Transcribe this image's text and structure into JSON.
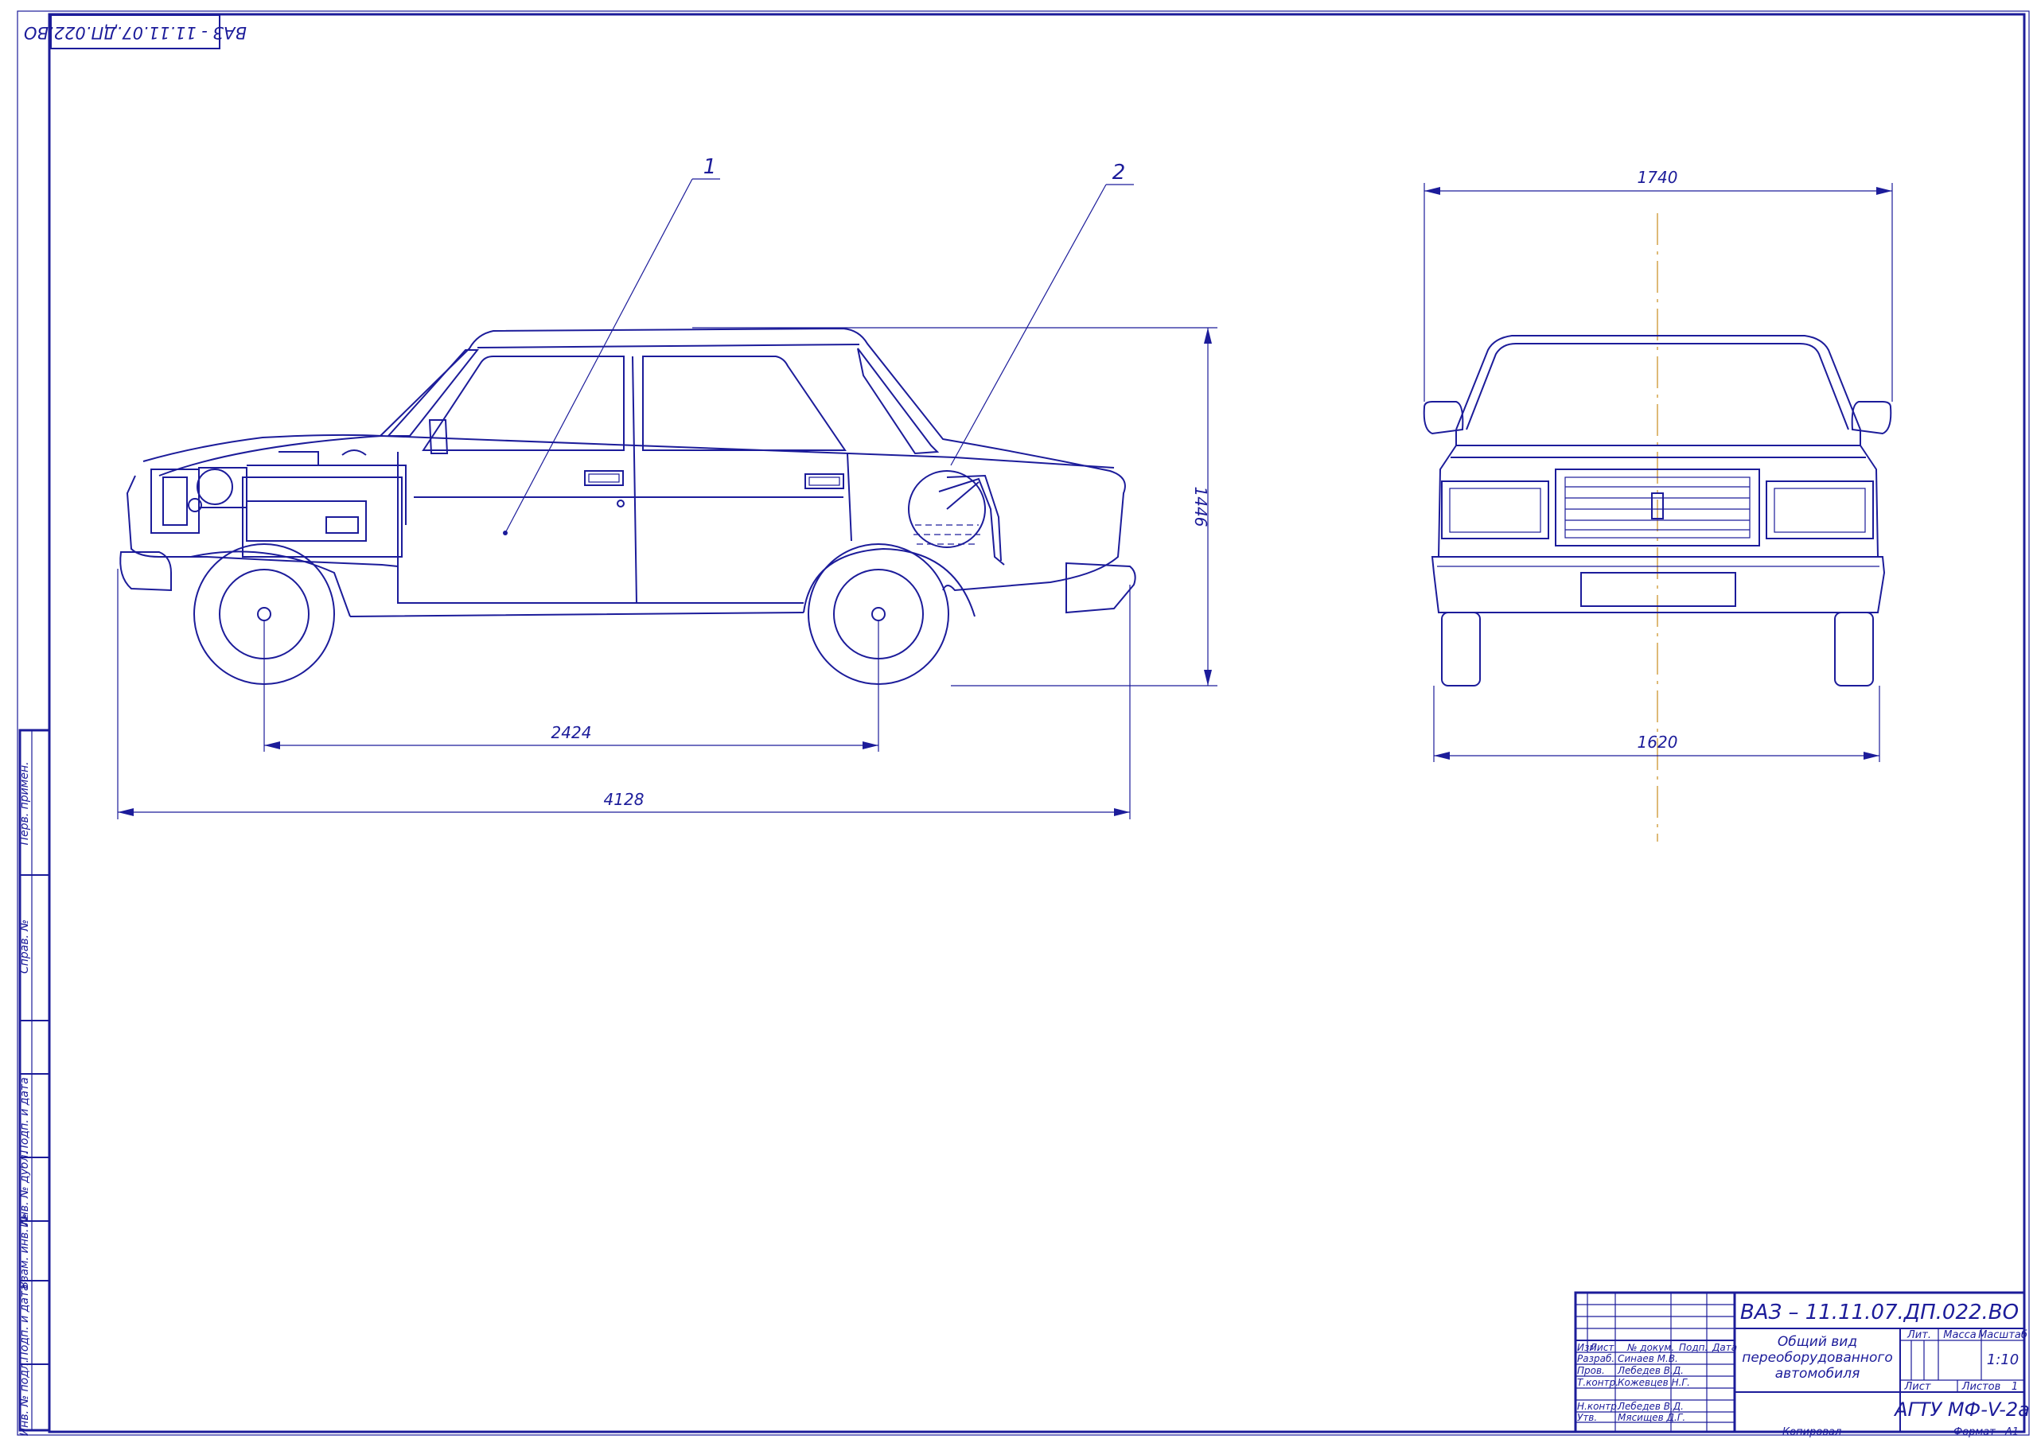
{
  "colors": {
    "line": "#1c1c9a",
    "axis": "#d4a44a",
    "background": "#ffffff"
  },
  "corner_stamp": "ВАЗ - 11.11.07.ДП.022.ВО",
  "callouts": {
    "item1": "1",
    "item2": "2"
  },
  "dimensions": {
    "wheelbase": "2424",
    "overall_length": "4128",
    "height": "1446",
    "width_top": "1740",
    "track": "1620"
  },
  "side_strip": {
    "perv_primen": "Перв. примен.",
    "sprav": "Справ. №",
    "podp_data_1": "Подп. и дата",
    "inv_dubl": "Инв. № дубл.",
    "vzam_inv": "Взам. инв. №",
    "podp_data_2": "Подп. и дата",
    "inv_podl": "Инв. № подл."
  },
  "title_block": {
    "doc_number": "ВАЗ – 11.11.07.ДП.022.ВО",
    "title_line1": "Общий вид",
    "title_line2": "переоборудованного",
    "title_line3": "автомобиля",
    "lit": "Лит.",
    "massa": "Масса",
    "masshtab": "Масштаб",
    "scale": "1:10",
    "list": "Лист",
    "listov": "Листов",
    "listov_value": "1",
    "organization": "АГТУ МФ-V-2а",
    "kopiroval": "Копировал",
    "format": "Формат",
    "format_value": "А1",
    "header": {
      "izm": "Изм.",
      "list": "Лист",
      "n_dokum": "№ докум.",
      "podp": "Подп.",
      "data": "Дата"
    },
    "roles": [
      {
        "role": "Разраб.",
        "name": "Синаев М.В."
      },
      {
        "role": "Пров.",
        "name": "Лебедев В.Д."
      },
      {
        "role": "Т.контр.",
        "name": "Кожевцев Н.Г."
      },
      {
        "role": "",
        "name": ""
      },
      {
        "role": "Н.контр.",
        "name": "Лебедев В.Д."
      },
      {
        "role": "Утв.",
        "name": "Мясищев Д.Г."
      }
    ]
  }
}
